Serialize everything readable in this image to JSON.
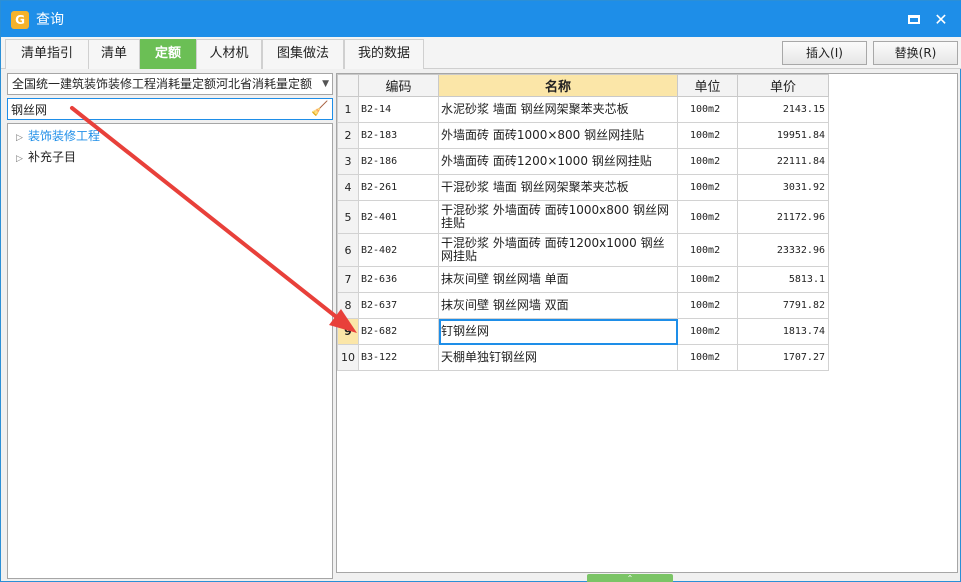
{
  "window": {
    "title": "查询",
    "app_icon_glyph": "G"
  },
  "tabs": [
    {
      "label": "清单指引",
      "active": false
    },
    {
      "label": "清单",
      "active": false
    },
    {
      "label": "定额",
      "active": true
    },
    {
      "label": "人材机",
      "active": false
    },
    {
      "label": "图集做法",
      "active": false
    },
    {
      "label": "我的数据",
      "active": false
    }
  ],
  "toolbar": {
    "insert_label": "插入(I)",
    "replace_label": "替换(R)"
  },
  "filter": {
    "library_value": "全国统一建筑装饰装修工程消耗量定额河北省消耗量定额",
    "search_value": "钢丝网"
  },
  "tree": [
    {
      "label": "装饰装修工程",
      "selected": true
    },
    {
      "label": "补充子目",
      "selected": false
    }
  ],
  "grid": {
    "columns": {
      "idx": "",
      "code": "编码",
      "name": "名称",
      "unit": "单位",
      "price": "单价"
    },
    "rows": [
      {
        "idx": "1",
        "code": "B2-14",
        "name": "水泥砂浆 墙面 钢丝网架聚苯夹芯板",
        "unit": "100m2",
        "price": "2143.15"
      },
      {
        "idx": "2",
        "code": "B2-183",
        "name": "外墙面砖 面砖1000×800 钢丝网挂贴",
        "unit": "100m2",
        "price": "19951.84"
      },
      {
        "idx": "3",
        "code": "B2-186",
        "name": "外墙面砖 面砖1200×1000 钢丝网挂贴",
        "unit": "100m2",
        "price": "22111.84"
      },
      {
        "idx": "4",
        "code": "B2-261",
        "name": "干混砂浆 墙面 钢丝网架聚苯夹芯板",
        "unit": "100m2",
        "price": "3031.92"
      },
      {
        "idx": "5",
        "code": "B2-401",
        "name": "干混砂浆 外墙面砖 面砖1000x800 钢丝网挂贴",
        "unit": "100m2",
        "price": "21172.96"
      },
      {
        "idx": "6",
        "code": "B2-402",
        "name": "干混砂浆 外墙面砖 面砖1200x1000 钢丝网挂贴",
        "unit": "100m2",
        "price": "23332.96"
      },
      {
        "idx": "7",
        "code": "B2-636",
        "name": "抹灰间壁 钢丝网墙 单面",
        "unit": "100m2",
        "price": "5813.1"
      },
      {
        "idx": "8",
        "code": "B2-637",
        "name": "抹灰间壁 钢丝网墙 双面",
        "unit": "100m2",
        "price": "7791.82"
      },
      {
        "idx": "9",
        "code": "B2-682",
        "name": "钉钢丝网",
        "unit": "100m2",
        "price": "1813.74"
      },
      {
        "idx": "10",
        "code": "B3-122",
        "name": "天棚单独钉钢丝网",
        "unit": "100m2",
        "price": "1707.27"
      }
    ],
    "current_row_index": 8
  },
  "colors": {
    "titlebar": "#1e8ee8",
    "active_tab": "#6bbf55",
    "annotation_arrow": "#e8403a",
    "header_highlight": "#fbe6a8"
  },
  "icons": {
    "maximize": "maximize-icon",
    "close": "close-icon",
    "clear_search": "broom-icon",
    "tree_expand": "triangle-right-icon",
    "grip": "chevron-up-icon"
  }
}
